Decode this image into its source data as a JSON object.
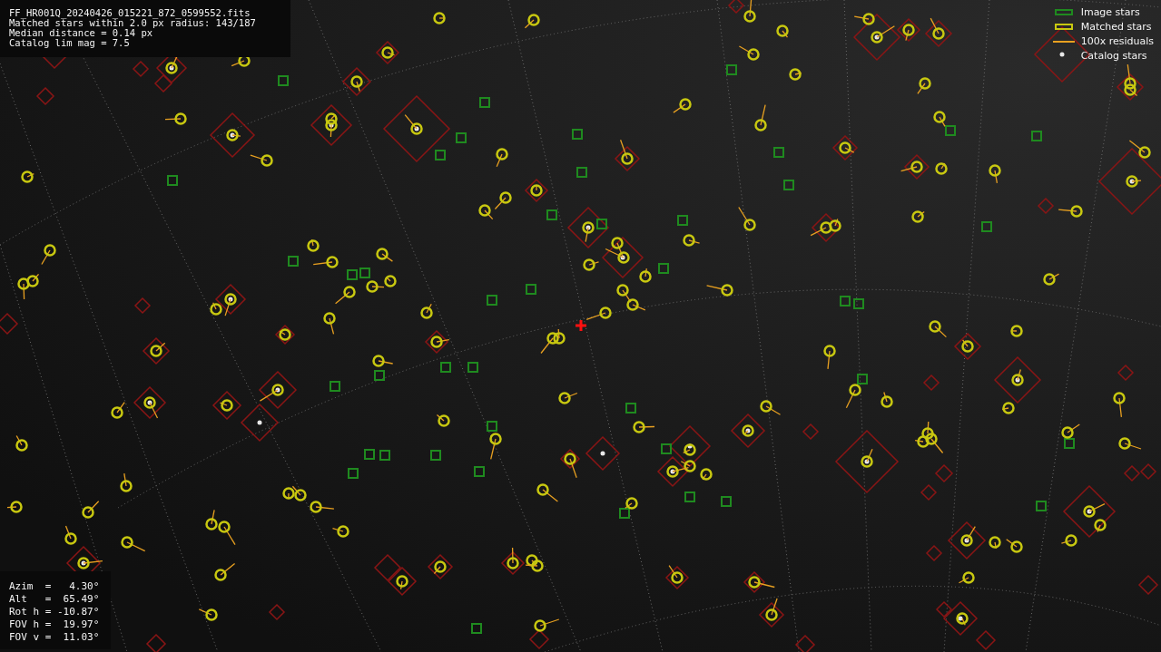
{
  "file_info": {
    "lines": [
      "FF_HR001Q_20240426_015221_872_0599552.fits",
      "Matched stars within 2.0 px radius: 143/187",
      "Median distance = 0.14 px",
      "Catalog lim mag = 7.5"
    ]
  },
  "legend": {
    "items": [
      {
        "label": "Image stars",
        "kind": "image"
      },
      {
        "label": "Matched stars",
        "kind": "matched"
      },
      {
        "label": "100x residuals",
        "kind": "residual"
      },
      {
        "label": "Catalog stars",
        "kind": "catalog"
      }
    ]
  },
  "pointing": {
    "lines": [
      "Azim  =   4.30°",
      "Alt   =  65.49°",
      "Rot h = -10.87°",
      "FOV h =  19.97°",
      "FOV v =  11.03°"
    ]
  }
}
